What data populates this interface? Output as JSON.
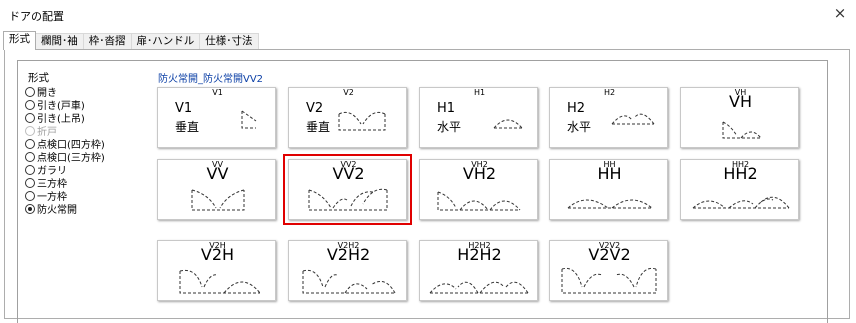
{
  "window": {
    "title": "ドアの配置",
    "close_glyph": "×"
  },
  "tabs": [
    {
      "label": "形式",
      "active": true
    },
    {
      "label": "欄間･袖",
      "active": false
    },
    {
      "label": "枠･沓摺",
      "active": false
    },
    {
      "label": "扉･ハンドル",
      "active": false
    },
    {
      "label": "仕様･寸法",
      "active": false
    }
  ],
  "form_type": {
    "label": "形式",
    "selected_name": "防火常開_防火常開VV2",
    "options": [
      {
        "label": "開き",
        "checked": false,
        "disabled": false
      },
      {
        "label": "引き(戸車)",
        "checked": false,
        "disabled": false
      },
      {
        "label": "引き(上吊)",
        "checked": false,
        "disabled": false
      },
      {
        "label": "折戸",
        "checked": false,
        "disabled": true
      },
      {
        "label": "点検口(四方枠)",
        "checked": false,
        "disabled": false
      },
      {
        "label": "点検口(三方枠)",
        "checked": false,
        "disabled": false
      },
      {
        "label": "ガラリ",
        "checked": false,
        "disabled": false
      },
      {
        "label": "三方枠",
        "checked": false,
        "disabled": false
      },
      {
        "label": "一方枠",
        "checked": false,
        "disabled": false
      },
      {
        "label": "防火常開",
        "checked": true,
        "disabled": false
      }
    ]
  },
  "tiles": [
    {
      "caption": "V1",
      "line1": "V1",
      "line2": "垂直",
      "selected": false
    },
    {
      "caption": "V2",
      "line1": "V2",
      "line2": "垂直",
      "selected": false
    },
    {
      "caption": "H1",
      "line1": "H1",
      "line2": "水平",
      "selected": false
    },
    {
      "caption": "H2",
      "line1": "H2",
      "line2": "水平",
      "selected": false
    },
    {
      "caption": "VH",
      "big": "VH",
      "selected": false
    },
    {
      "caption": "VV",
      "big": "VV",
      "selected": false
    },
    {
      "caption": "VV2",
      "big": "VV2",
      "selected": true
    },
    {
      "caption": "VH2",
      "big": "VH2",
      "selected": false
    },
    {
      "caption": "HH",
      "big": "HH",
      "selected": false
    },
    {
      "caption": "HH2",
      "big": "HH2",
      "selected": false
    },
    {
      "caption": "V2H",
      "big": "V2H",
      "selected": false
    },
    {
      "caption": "V2H2",
      "big": "V2H2",
      "selected": false
    },
    {
      "caption": "H2H2",
      "big": "H2H2",
      "selected": false
    },
    {
      "caption": "V2V2",
      "big": "V2V2",
      "selected": false
    }
  ],
  "colors": {
    "selection_outline": "#e00000",
    "selected_name_text": "#0b3fa6"
  }
}
